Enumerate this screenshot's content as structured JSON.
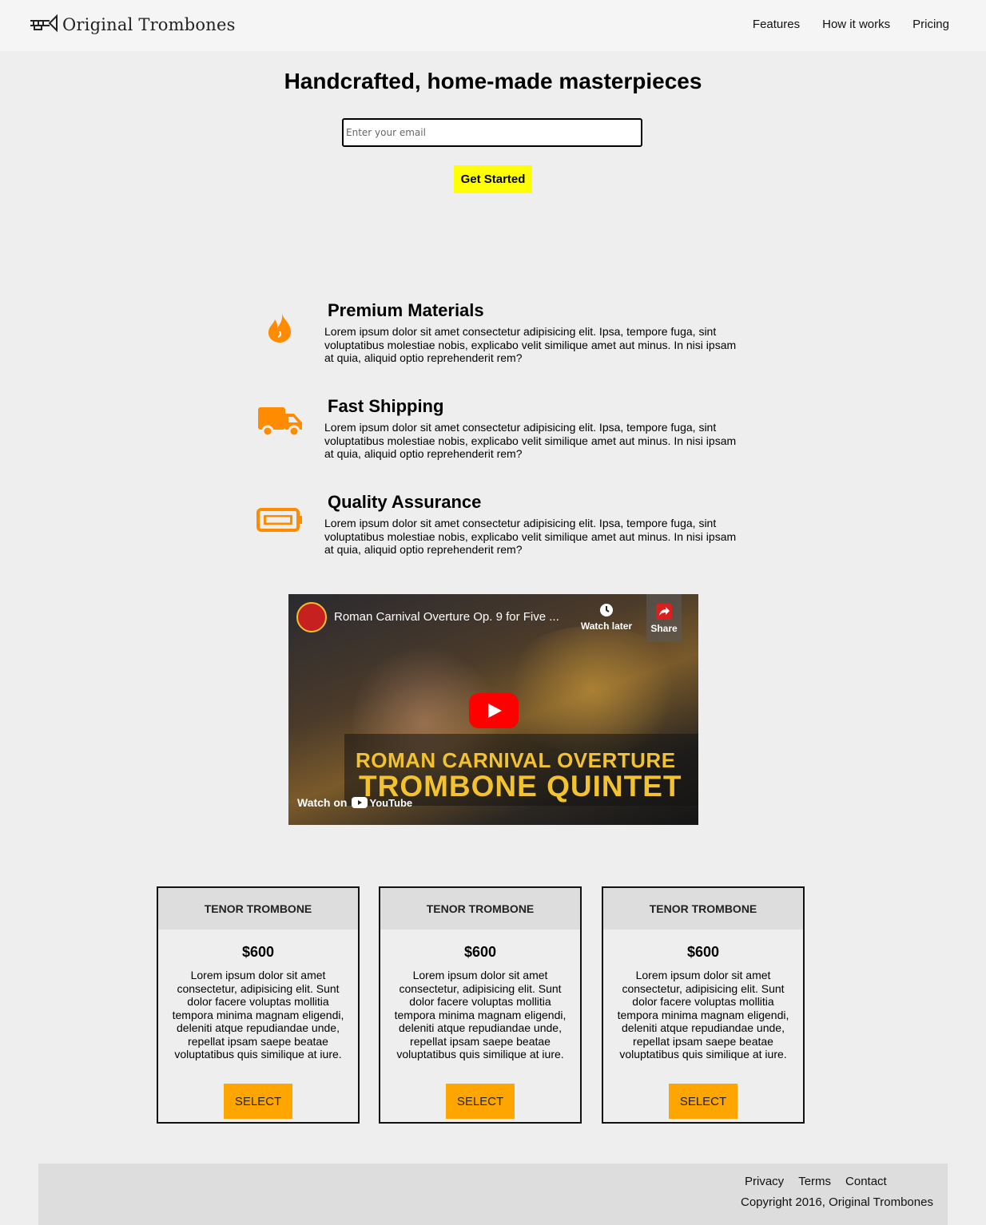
{
  "header": {
    "brand": "Original Trombones",
    "nav": [
      "Features",
      "How it works",
      "Pricing"
    ]
  },
  "hero": {
    "title": "Handcrafted, home-made masterpieces",
    "email_placeholder": "Enter your email",
    "cta_label": "Get Started"
  },
  "features": [
    {
      "icon": "fire-icon",
      "title": "Premium Materials",
      "text": "Lorem ipsum dolor sit amet consectetur adipisicing elit. Ipsa, tempore fuga, sint voluptatibus molestiae nobis, explicabo velit similique amet aut minus. In nisi ipsam at quia, aliquid optio reprehenderit rem?"
    },
    {
      "icon": "truck-icon",
      "title": "Fast Shipping",
      "text": "Lorem ipsum dolor sit amet consectetur adipisicing elit. Ipsa, tempore fuga, sint voluptatibus molestiae nobis, explicabo velit similique amet aut minus. In nisi ipsam at quia, aliquid optio reprehenderit rem?"
    },
    {
      "icon": "battery-icon",
      "title": "Quality Assurance",
      "text": "Lorem ipsum dolor sit amet consectetur adipisicing elit. Ipsa, tempore fuga, sint voluptatibus molestiae nobis, explicabo velit similique amet aut minus. In nisi ipsam at quia, aliquid optio reprehenderit rem?"
    }
  ],
  "video": {
    "title": "Roman Carnival Overture Op. 9 for Five ...",
    "watch_later": "Watch later",
    "share": "Share",
    "overlay_line1": "ROMAN CARNIVAL OVERTURE",
    "overlay_line2": "TROMBONE QUINTET",
    "watch_on": "Watch on",
    "platform": "YouTube"
  },
  "pricing": [
    {
      "name": "TENOR TROMBONE",
      "price": "$600",
      "description": "Lorem ipsum dolor sit amet consectetur, adipisicing elit. Sunt dolor facere voluptas mollitia tempora minima magnam eligendi, deleniti atque repudiandae unde, repellat ipsam saepe beatae voluptatibus quis similique at iure.",
      "button": "SELECT"
    },
    {
      "name": "TENOR TROMBONE",
      "price": "$600",
      "description": "Lorem ipsum dolor sit amet consectetur, adipisicing elit. Sunt dolor facere voluptas mollitia tempora minima magnam eligendi, deleniti atque repudiandae unde, repellat ipsam saepe beatae voluptatibus quis similique at iure.",
      "button": "SELECT"
    },
    {
      "name": "TENOR TROMBONE",
      "price": "$600",
      "description": "Lorem ipsum dolor sit amet consectetur, adipisicing elit. Sunt dolor facere voluptas mollitia tempora minima magnam eligendi, deleniti atque repudiandae unde, repellat ipsam saepe beatae voluptatibus quis similique at iure.",
      "button": "SELECT"
    }
  ],
  "footer": {
    "links": [
      "Privacy",
      "Terms",
      "Contact"
    ],
    "copyright": "Copyright 2016, Original Trombones"
  },
  "colors": {
    "accent_yellow": "#ffff00",
    "accent_orange": "#ff8c00",
    "select_orange": "#ffa500",
    "page_bg": "#eeeeee"
  }
}
